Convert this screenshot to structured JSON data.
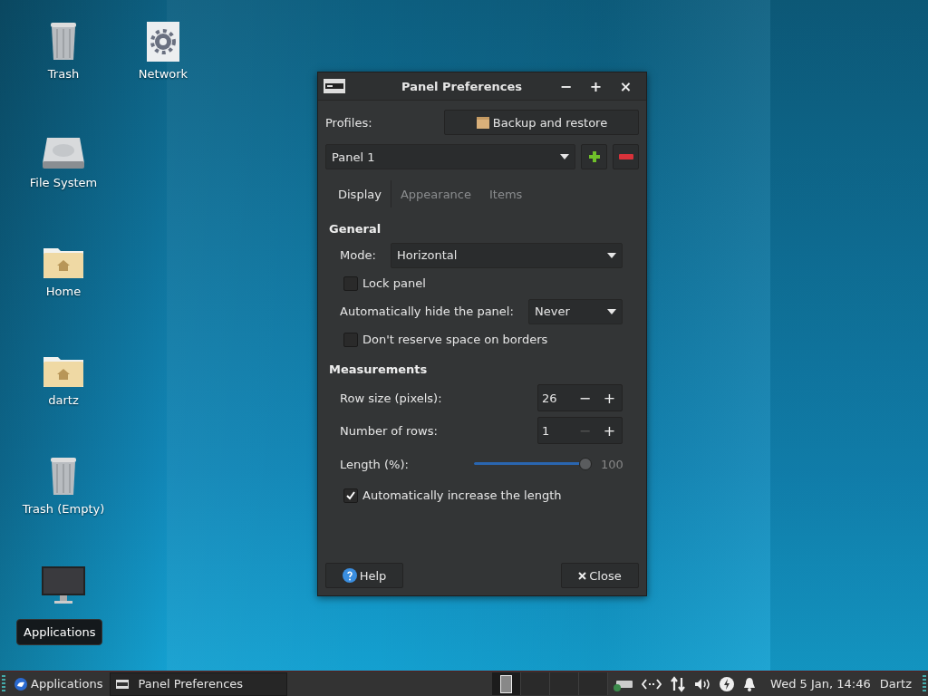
{
  "desktop": {
    "columns": [
      [
        {
          "kind": "trash",
          "label": "Trash"
        },
        {
          "kind": "drive",
          "label": "File System"
        },
        {
          "kind": "home-folder",
          "label": "Home"
        },
        {
          "kind": "home-folder",
          "label": "dartz"
        },
        {
          "kind": "trash",
          "label": "Trash (Empty)"
        },
        {
          "kind": "computer"
        }
      ],
      [
        {
          "kind": "network",
          "label": "Network"
        }
      ]
    ]
  },
  "tooltip": {
    "text": "Applications"
  },
  "window": {
    "title": "Panel Preferences",
    "controls": [
      "−",
      "+",
      "×"
    ],
    "profiles": {
      "label": "Profiles:",
      "button": "Backup and restore"
    },
    "panel_select": {
      "value": "Panel 1"
    },
    "tabs": [
      {
        "label": "Display",
        "selected": true
      },
      {
        "label": "Appearance",
        "selected": false
      },
      {
        "label": "Items",
        "selected": false
      }
    ],
    "sections": [
      {
        "heading": "General",
        "rows": [
          {
            "kind": "combo",
            "label": "Mode:",
            "value": "Horizontal"
          },
          {
            "kind": "checkbox",
            "label": "Lock panel",
            "checked": false
          },
          {
            "kind": "combo",
            "label": "Automatically hide the panel:",
            "value": "Never"
          },
          {
            "kind": "checkbox",
            "label": "Don't reserve space on borders",
            "checked": false
          }
        ]
      },
      {
        "heading": "Measurements",
        "rows": [
          {
            "kind": "spin",
            "label": "Row size (pixels):",
            "value": "26",
            "decrement": "−",
            "increment": "+",
            "decrement_disabled": false
          },
          {
            "kind": "spin",
            "label": "Number of rows:",
            "value": "1",
            "decrement": "−",
            "increment": "+",
            "decrement_disabled": true
          },
          {
            "kind": "slider",
            "label": "Length (%):",
            "level": 1,
            "reading": "100"
          },
          {
            "kind": "checkbox",
            "label": "Automatically increase the length",
            "checked": true
          }
        ]
      }
    ],
    "buttons": [
      {
        "kind": "help",
        "label": "Help"
      },
      {
        "kind": "close",
        "label": "Close"
      }
    ]
  },
  "taskbar": {
    "menu": "Applications",
    "tasks": [
      {
        "label": "Panel Preferences",
        "selected": true
      }
    ],
    "workspaces": [
      {
        "selected": true
      },
      {
        "selected": false
      },
      {
        "selected": false
      },
      {
        "selected": false
      }
    ],
    "clock": "Wed  5 Jan, 14:46",
    "user": "Dartz"
  }
}
